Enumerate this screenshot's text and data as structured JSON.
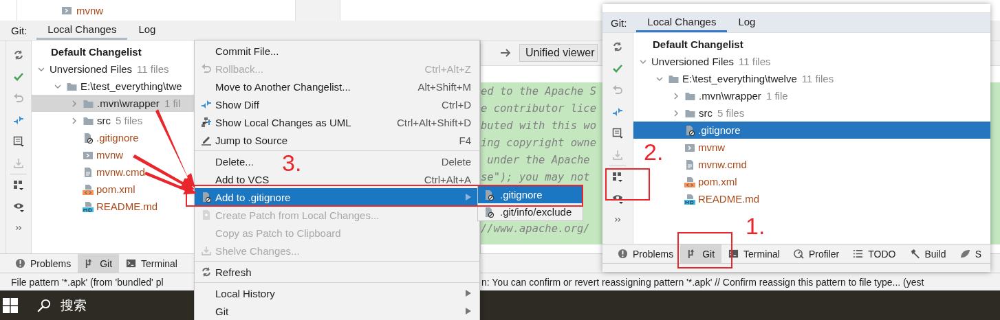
{
  "project_tree": {
    "item": "mvnw"
  },
  "git_panel": {
    "label": "Git:",
    "tabs": [
      {
        "label": "Local Changes",
        "selected": true
      },
      {
        "label": "Log",
        "selected": false
      }
    ],
    "changelist": "Default Changelist",
    "tree": [
      {
        "label": "Unversioned Files",
        "count": "11 files",
        "kind": "group",
        "expanded": true,
        "selected": false,
        "children": [
          {
            "label": "E:\\test_everything\\twe",
            "kind": "folder",
            "expanded": true,
            "selected": false,
            "children": [
              {
                "label": ".mvn\\wrapper",
                "count": "1 fil",
                "kind": "folder",
                "expanded": false,
                "selected": true
              },
              {
                "label": "src",
                "count": "5 files",
                "kind": "folder",
                "expanded": false,
                "selected": false
              },
              {
                "label": ".gitignore",
                "kind": "ignore",
                "selected": false
              },
              {
                "label": "mvnw",
                "kind": "script",
                "selected": false
              },
              {
                "label": "mvnw.cmd",
                "kind": "text",
                "selected": false
              },
              {
                "label": "pom.xml",
                "kind": "xml",
                "selected": false
              },
              {
                "label": "README.md",
                "kind": "markdown",
                "selected": false
              }
            ]
          }
        ]
      }
    ]
  },
  "diff": {
    "viewer": "Unified viewer",
    "code_lines": [
      "ed to the Apache S",
      "e contributor lice",
      "buted with this wo",
      "ing copyright owne",
      " under the Apache",
      "se\"); you may not",
      "//www.apache.org/"
    ]
  },
  "bottom_tabs": [
    {
      "label": "Problems",
      "selected": false
    },
    {
      "label": "Git",
      "selected": true
    },
    {
      "label": "Terminal",
      "selected": false
    }
  ],
  "status_bar": [
    "File pattern '*.apk' (from 'bundled' pl",
    "n: You can confirm or revert reassigning pattern '*.apk' // Confirm reassign this pattern to file type... (yest"
  ],
  "taskbar": {
    "search": "搜索"
  },
  "context_menu": [
    {
      "label": "Commit File...",
      "disabled": false,
      "selected": false,
      "submenu": false,
      "separator_before": false
    },
    {
      "label": "Rollback...",
      "shortcut": "Ctrl+Alt+Z",
      "disabled": true,
      "selected": false,
      "submenu": false,
      "separator_before": false
    },
    {
      "label": "Move to Another Changelist...",
      "shortcut": "Alt+Shift+M",
      "disabled": false,
      "selected": false,
      "submenu": false,
      "separator_before": false
    },
    {
      "label": "Show Diff",
      "shortcut": "Ctrl+D",
      "disabled": false,
      "selected": false,
      "submenu": false,
      "separator_before": false
    },
    {
      "label": "Show Local Changes as UML",
      "shortcut": "Ctrl+Alt+Shift+D",
      "disabled": false,
      "selected": false,
      "submenu": false,
      "separator_before": false
    },
    {
      "label": "Jump to Source",
      "shortcut": "F4",
      "disabled": false,
      "selected": false,
      "submenu": false,
      "separator_before": false
    },
    {
      "label": "Delete...",
      "shortcut": "Delete",
      "disabled": false,
      "selected": false,
      "submenu": false,
      "separator_before": true
    },
    {
      "label": "Add to VCS",
      "shortcut": "Ctrl+Alt+A",
      "disabled": false,
      "selected": false,
      "submenu": false,
      "separator_before": false
    },
    {
      "label": "Add to .gitignore",
      "disabled": false,
      "selected": true,
      "submenu": true,
      "separator_before": false
    },
    {
      "label": "Create Patch from Local Changes...",
      "disabled": true,
      "selected": false,
      "submenu": false,
      "separator_before": false
    },
    {
      "label": "Copy as Patch to Clipboard",
      "disabled": true,
      "selected": false,
      "submenu": false,
      "separator_before": false
    },
    {
      "label": "Shelve Changes...",
      "disabled": true,
      "selected": false,
      "submenu": false,
      "separator_before": false
    },
    {
      "label": "Refresh",
      "disabled": false,
      "selected": false,
      "submenu": false,
      "separator_before": true
    },
    {
      "label": "Local History",
      "disabled": false,
      "selected": false,
      "submenu": true,
      "separator_before": true
    },
    {
      "label": "Git",
      "disabled": false,
      "selected": false,
      "submenu": true,
      "separator_before": false
    }
  ],
  "submenu": [
    {
      "label": ".gitignore",
      "selected": true
    },
    {
      "label": ".git/info/exclude",
      "selected": false
    }
  ],
  "inset_panel": {
    "label": "Git:",
    "tabs": [
      {
        "label": "Local Changes",
        "selected": true
      },
      {
        "label": "Log",
        "selected": false
      }
    ],
    "changelist": "Default Changelist",
    "tree": [
      {
        "label": "Unversioned Files",
        "count": "11 files",
        "kind": "group",
        "expanded": true,
        "selected": false,
        "children": [
          {
            "label": "E:\\test_everything\\twelve",
            "count": "11 files",
            "kind": "folder",
            "expanded": true,
            "selected": false,
            "children": [
              {
                "label": ".mvn\\wrapper",
                "count": "1 file",
                "kind": "folder",
                "expanded": false,
                "selected": false
              },
              {
                "label": "src",
                "count": "5 files",
                "kind": "folder",
                "expanded": false,
                "selected": false
              },
              {
                "label": ".gitignore",
                "kind": "ignore",
                "selected": true
              },
              {
                "label": "mvnw",
                "kind": "script",
                "selected": false
              },
              {
                "label": "mvnw.cmd",
                "kind": "text",
                "selected": false
              },
              {
                "label": "pom.xml",
                "kind": "xml",
                "selected": false
              },
              {
                "label": "README.md",
                "kind": "markdown",
                "selected": false
              }
            ]
          }
        ]
      }
    ],
    "bottom_tabs": [
      {
        "label": "Problems",
        "selected": false
      },
      {
        "label": "Git",
        "selected": true
      },
      {
        "label": "Terminal",
        "selected": false
      },
      {
        "label": "Profiler",
        "selected": false
      },
      {
        "label": "TODO",
        "selected": false
      },
      {
        "label": "Build",
        "selected": false
      },
      {
        "label": "S",
        "selected": false
      }
    ]
  },
  "annotations": [
    "3.",
    "2.",
    "1."
  ]
}
